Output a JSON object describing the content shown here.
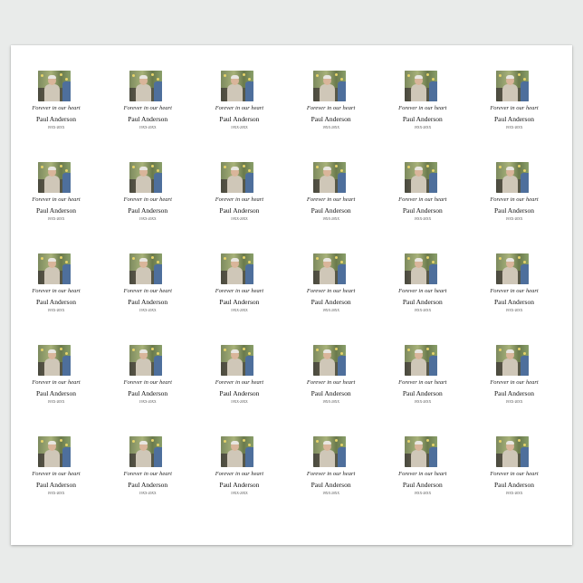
{
  "sheet": {
    "rows": 5,
    "columns": 6,
    "label": {
      "tagline": "Forever in our heart",
      "name": "Paul Anderson",
      "dates": "19XX-20XX"
    }
  },
  "colors": {
    "background": "#e9ebea",
    "sheet": "#ffffff",
    "text": "#111111"
  }
}
